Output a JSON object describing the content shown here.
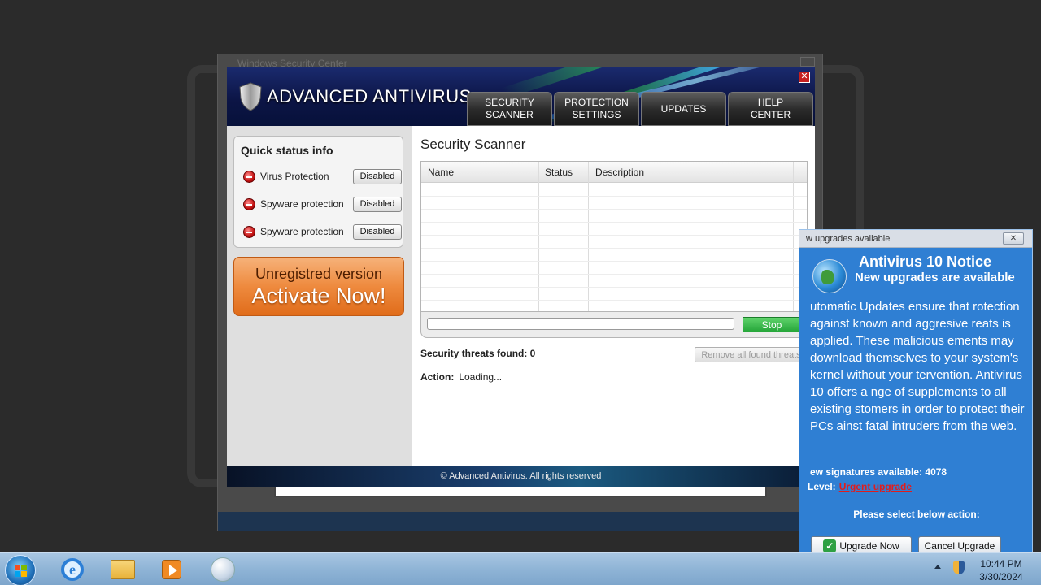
{
  "background_window": {
    "title": "Windows Security Center"
  },
  "app": {
    "title": "ADVANCED ANTIVIRUS",
    "close_label": "✕",
    "tabs": [
      {
        "line1": "SECURITY",
        "line2": "SCANNER"
      },
      {
        "line1": "PROTECTION",
        "line2": "SETTINGS"
      },
      {
        "line1": "UPDATES",
        "line2": ""
      },
      {
        "line1": "HELP",
        "line2": "CENTER"
      }
    ],
    "footer": "© Advanced Antivirus. All rights reserved"
  },
  "sidebar": {
    "status_title": "Quick status info",
    "rows": [
      {
        "label": "Virus Protection",
        "button": "Disabled"
      },
      {
        "label": "Spyware protection",
        "button": "Disabled"
      },
      {
        "label": "Spyware protection",
        "button": "Disabled"
      }
    ],
    "activate_line1": "Unregistred version",
    "activate_line2": "Activate Now!"
  },
  "scanner": {
    "title": "Security Scanner",
    "columns": [
      "Name",
      "Status",
      "Description"
    ],
    "stop_label": "Stop",
    "threats_label": "Security threats found: 0",
    "remove_label": "Remove all found threats",
    "action_label": "Action:",
    "action_value": "Loading..."
  },
  "notice": {
    "bar_title": "w upgrades available",
    "close_label": "✕",
    "title": "Antivirus 10 Notice",
    "subtitle": "New upgrades are available",
    "body": "utomatic Updates ensure that rotection against known and aggresive reats is applied. These malicious ements may download themselves to your system's kernel without your tervention. Antivirus 10 offers a nge of supplements to all existing stomers in order to protect their PCs ainst fatal intruders from the web.",
    "signatures": "ew signatures available: 4078",
    "level_label": "Level:",
    "level_value": "Urgent upgrade",
    "level_color": "#e21c1c",
    "select_text": "Please select below action:",
    "upgrade_label": "Upgrade Now",
    "cancel_label": "Cancel Upgrade"
  },
  "taskbar": {
    "time": "10:44 PM",
    "date": "3/30/2024"
  }
}
